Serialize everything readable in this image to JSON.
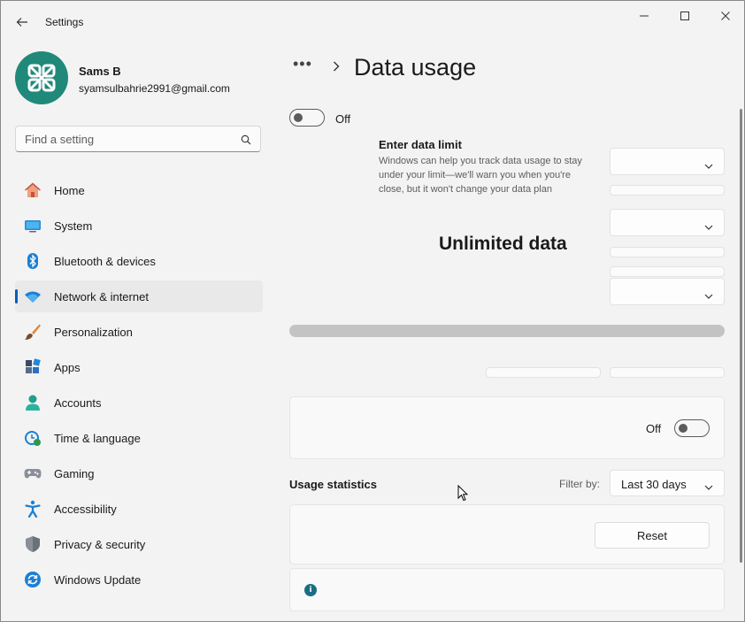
{
  "app": {
    "title": "Settings"
  },
  "profile": {
    "name": "Sams B",
    "email": "syamsulbahrie2991@gmail.com"
  },
  "search": {
    "placeholder": "Find a setting"
  },
  "nav": [
    {
      "label": "Home",
      "icon": "home-icon"
    },
    {
      "label": "System",
      "icon": "system-icon"
    },
    {
      "label": "Bluetooth & devices",
      "icon": "bluetooth-icon"
    },
    {
      "label": "Network & internet",
      "icon": "wifi-icon",
      "selected": true
    },
    {
      "label": "Personalization",
      "icon": "brush-icon"
    },
    {
      "label": "Apps",
      "icon": "apps-icon"
    },
    {
      "label": "Accounts",
      "icon": "accounts-icon"
    },
    {
      "label": "Time & language",
      "icon": "clock-globe-icon"
    },
    {
      "label": "Gaming",
      "icon": "gamepad-icon"
    },
    {
      "label": "Accessibility",
      "icon": "accessibility-icon"
    },
    {
      "label": "Privacy & security",
      "icon": "shield-icon"
    },
    {
      "label": "Windows Update",
      "icon": "update-icon"
    }
  ],
  "header": {
    "breadcrumb_more": "•••",
    "title": "Data usage"
  },
  "limit_toggle": {
    "state": "Off"
  },
  "data_limit": {
    "title": "Enter data limit",
    "description": "Windows can help you track data usage to stay under your limit—we'll warn you when you're close, but it won't change your data plan"
  },
  "usage_label": "Unlimited data",
  "background_toggle": {
    "state": "Off"
  },
  "usage_statistics": {
    "title": "Usage statistics",
    "filter_label": "Filter by:",
    "filter_value": "Last 30 days",
    "reset_label": "Reset"
  },
  "info_icon_glyph": "i",
  "colors": {
    "accent": "#005fb8",
    "avatar": "#20897a",
    "progress": "#c3c3c3"
  }
}
